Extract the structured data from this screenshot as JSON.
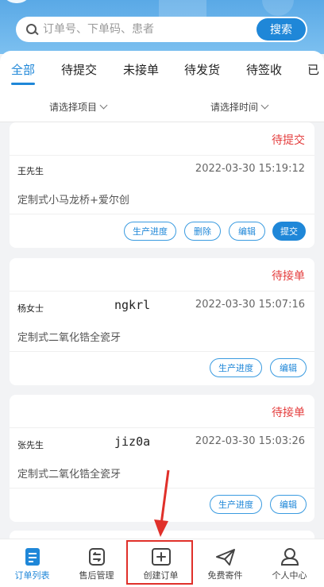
{
  "search": {
    "placeholder": "订单号、下单码、患者",
    "button": "搜索"
  },
  "tabs": [
    "全部",
    "待提交",
    "未接单",
    "待发货",
    "待签收",
    "已"
  ],
  "filters": {
    "project": "请选择项目",
    "time": "请选择时间"
  },
  "orders": [
    {
      "status": "待提交",
      "name": "王先生",
      "code": "",
      "time": "2022-03-30 15:19:12",
      "product": "定制式小马龙桥+爱尔创",
      "actions": [
        "生产进度",
        "删除",
        "编辑"
      ],
      "primary": "提交"
    },
    {
      "status": "待接单",
      "name": "杨女士",
      "code": "ngkrl",
      "time": "2022-03-30 15:07:16",
      "product": "定制式二氧化锆全瓷牙",
      "actions": [
        "生产进度",
        "编辑"
      ],
      "primary": ""
    },
    {
      "status": "待接单",
      "name": "张先生",
      "code": "jiz0a",
      "time": "2022-03-30 15:03:26",
      "product": "定制式二氧化锆全瓷牙",
      "actions": [
        "生产进度",
        "编辑"
      ],
      "primary": ""
    }
  ],
  "nav": [
    {
      "label": "订单列表",
      "icon": "order-list-icon",
      "active": true
    },
    {
      "label": "售后管理",
      "icon": "after-sales-icon",
      "active": false
    },
    {
      "label": "创建订单",
      "icon": "create-order-icon",
      "active": false
    },
    {
      "label": "免费寄件",
      "icon": "send-icon",
      "active": false
    },
    {
      "label": "个人中心",
      "icon": "profile-icon",
      "active": false
    }
  ],
  "colors": {
    "accent": "#1f87d8",
    "status_red": "#e43d3d",
    "highlight": "#e0302a"
  }
}
